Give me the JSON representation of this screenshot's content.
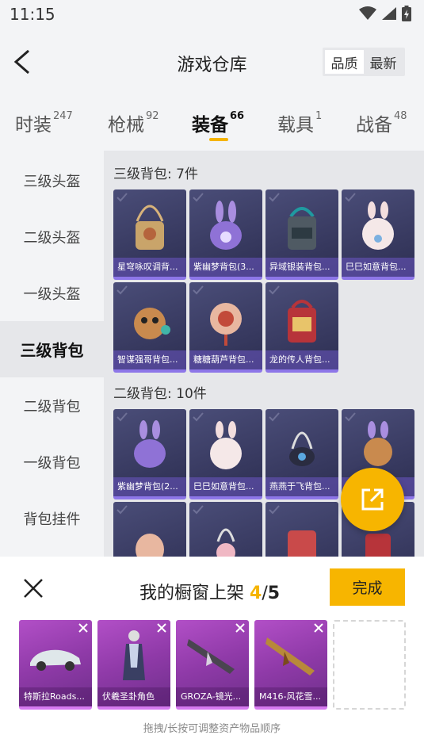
{
  "status": {
    "time": "11:15"
  },
  "header": {
    "title": "游戏仓库",
    "sort_quality": "品质",
    "sort_newest": "最新"
  },
  "tabs": [
    {
      "label": "时装",
      "count": "247"
    },
    {
      "label": "枪械",
      "count": "92"
    },
    {
      "label": "装备",
      "count": "66"
    },
    {
      "label": "载具",
      "count": "1"
    },
    {
      "label": "战备",
      "count": "48"
    }
  ],
  "sidebar": {
    "items": [
      {
        "label": "三级头盔"
      },
      {
        "label": "二级头盔"
      },
      {
        "label": "一级头盔"
      },
      {
        "label": "三级背包"
      },
      {
        "label": "二级背包"
      },
      {
        "label": "一级背包"
      },
      {
        "label": "背包挂件"
      }
    ]
  },
  "sections": [
    {
      "title": "三级背包: 7件",
      "items": [
        {
          "label": "星穹咏叹调背..."
        },
        {
          "label": "紫幽梦背包(3..."
        },
        {
          "label": "异域银装背包..."
        },
        {
          "label": "巳巳如意背包..."
        },
        {
          "label": "智谋强哥背包..."
        },
        {
          "label": "糖糖葫芦背包..."
        },
        {
          "label": "龙的传人背包..."
        }
      ]
    },
    {
      "title": "二级背包: 10件",
      "items": [
        {
          "label": "紫幽梦背包(2..."
        },
        {
          "label": "巳巳如意背包..."
        },
        {
          "label": "燕燕于飞背包..."
        },
        {
          "label": ""
        }
      ]
    }
  ],
  "panel": {
    "title": "我的橱窗上架",
    "current": "4",
    "separator": "/",
    "total": "5",
    "done_label": "完成",
    "slots": [
      {
        "label": "特斯拉Roads..."
      },
      {
        "label": "伏羲圣卦角色"
      },
      {
        "label": "GROZA-镜光..."
      },
      {
        "label": "M416-风花雪..."
      }
    ],
    "hint": "拖拽/长按可调整资产物品顺序"
  }
}
